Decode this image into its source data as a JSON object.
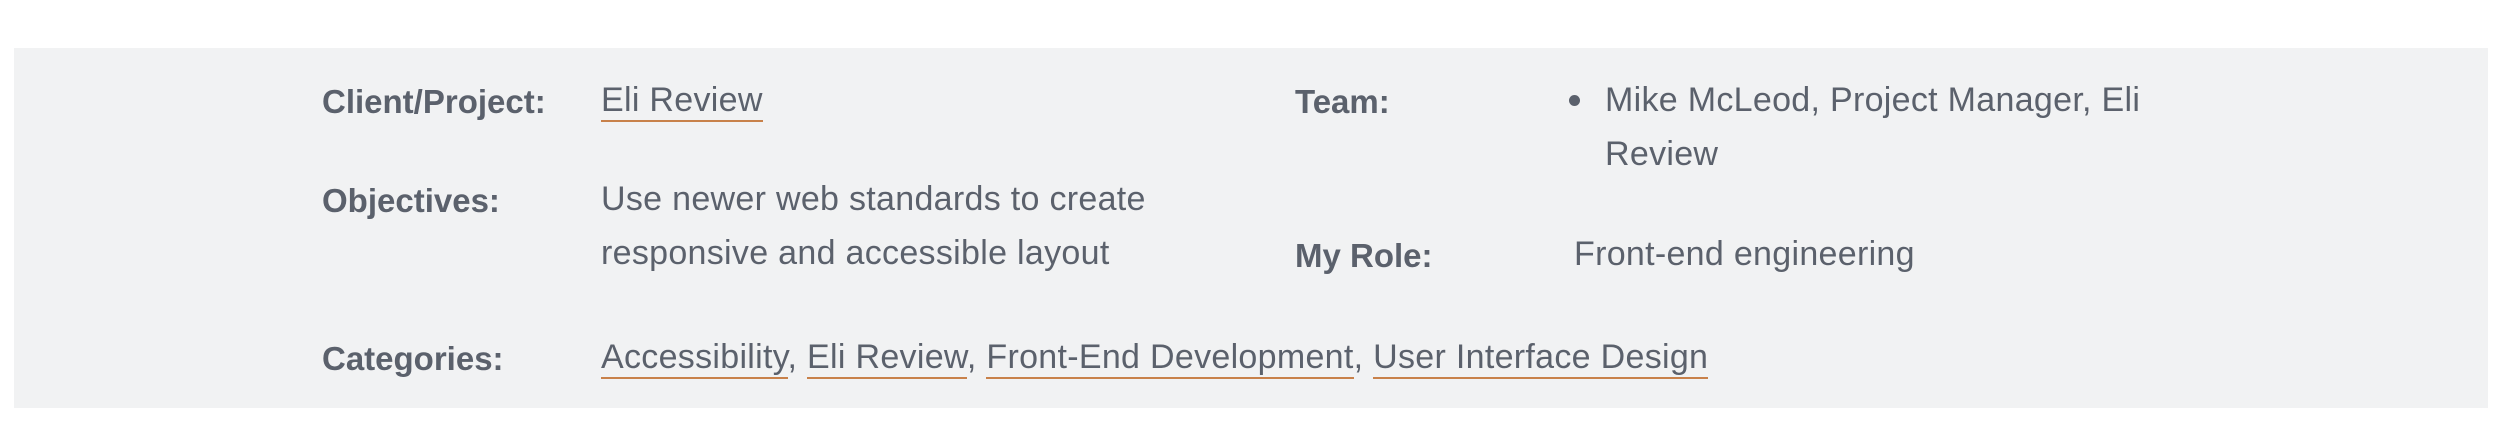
{
  "project": {
    "client_label": "Client/Project:",
    "client_value": "Eli Review",
    "objectives_label": "Objectives:",
    "objectives_value": "Use newer web standards to create responsive and accessible layout",
    "categories_label": "Categories:",
    "categories": [
      {
        "label": "Accessibility",
        "sep": ","
      },
      {
        "label": "Eli Review",
        "sep": ","
      },
      {
        "label": "Front-End Development",
        "sep": ","
      },
      {
        "label": "User Interface Design",
        "sep": ""
      }
    ],
    "team_label": "Team:",
    "team_members": [
      "Mike McLeod, Project Manager, Eli Review"
    ],
    "role_label": "My Role:",
    "role_value": "Front-end engineering"
  },
  "colors": {
    "background": "#f1f2f3",
    "text": "#5b616c",
    "link_underline": "#c8814a"
  }
}
